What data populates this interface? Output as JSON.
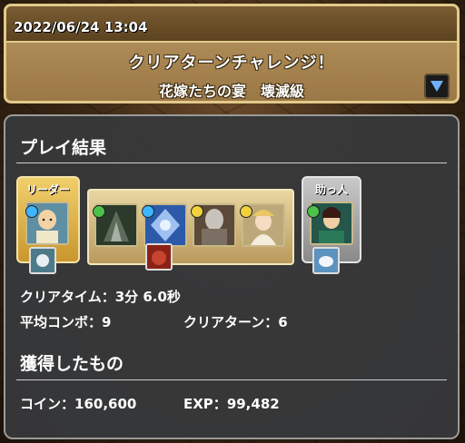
{
  "header": {
    "datetime": "2022/06/24 13:04",
    "title": "クリアターンチャレンジ！",
    "dungeon_name": "花嫁たちの宴",
    "difficulty": "壊滅級",
    "dropdown_icon": "triangle-down-icon"
  },
  "results": {
    "section_title": "プレイ結果",
    "leader_label": "リーダー",
    "helper_label": "助っ人",
    "clear_time_label": "クリアタイム：",
    "clear_time_value": "3分 6.0秒",
    "avg_combo_label": "平均コンボ：",
    "avg_combo_value": "9",
    "clear_turn_label": "クリアターン：",
    "clear_turn_value": "6"
  },
  "rewards": {
    "section_title": "獲得したもの",
    "coin_label": "コイン：",
    "coin_value": "160,600",
    "exp_label": "EXP：",
    "exp_value": "99,482"
  },
  "colors": {
    "accent_gold": "#e2c98a",
    "panel_bg": "#37383a",
    "leader_frame": "#f1cf6b",
    "helper_frame": "#c8c8c8"
  }
}
